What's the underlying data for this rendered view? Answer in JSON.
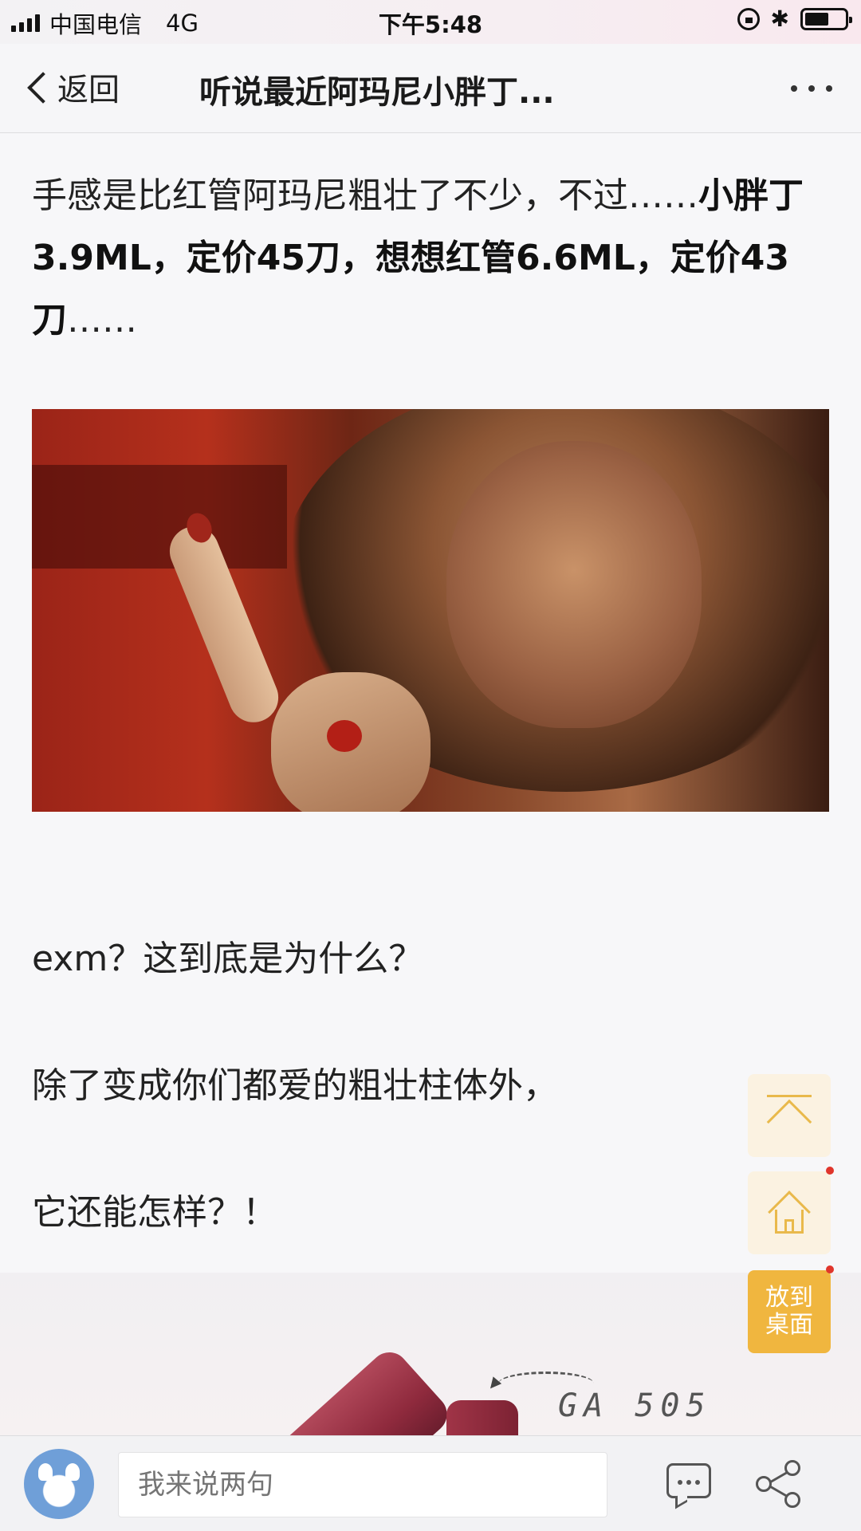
{
  "status_bar": {
    "carrier": "中国电信",
    "network": "4G",
    "time": "下午5:48",
    "icons": [
      "signal-icon",
      "orientation-lock-icon",
      "bluetooth-icon",
      "battery-icon"
    ]
  },
  "nav": {
    "back_label": "返回",
    "title": "听说最近阿玛尼小胖丁...",
    "more_icon": "more-icon"
  },
  "article": {
    "para1_normal": "手感是比红管阿玛尼粗壮了不少，不过……",
    "para1_bold": "小胖丁3.9ML，定价45刀，想想红管6.6ML，定价43刀",
    "para1_tail": "……",
    "para2": "exm？这到底是为什么？",
    "para3": "除了变成你们都爱的粗壮柱体外，",
    "para4": "它还能怎样？！",
    "product_code": "GA 505"
  },
  "floating": {
    "desk_label_1": "放到",
    "desk_label_2": "桌面"
  },
  "bottom_bar": {
    "comment_placeholder": "我来说两句"
  },
  "colors": {
    "accent": "#f0b63f",
    "float_bg": "#fbf2e1",
    "badge": "#e0352b"
  }
}
